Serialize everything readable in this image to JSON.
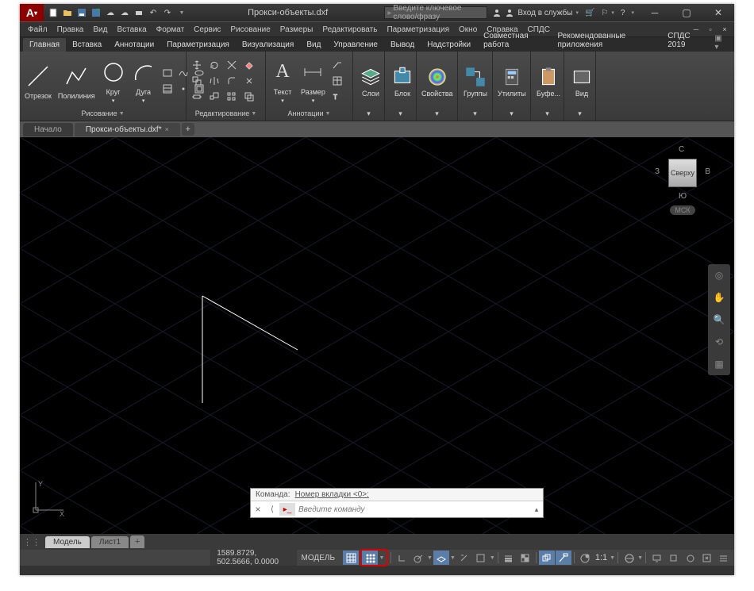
{
  "title_bar": {
    "doc_title": "Прокси-объекты.dxf",
    "search_placeholder": "Введите ключевое слово/фразу",
    "login_label": "Вход в службы",
    "logo_letter": "A"
  },
  "menu": [
    "Файл",
    "Правка",
    "Вид",
    "Вставка",
    "Формат",
    "Сервис",
    "Рисование",
    "Размеры",
    "Редактировать",
    "Параметризация",
    "Окно",
    "Справка",
    "СПДС"
  ],
  "ribbon_tabs": [
    "Главная",
    "Вставка",
    "Аннотации",
    "Параметризация",
    "Визуализация",
    "Вид",
    "Управление",
    "Вывод",
    "Надстройки",
    "Совместная работа",
    "Рекомендованные приложения",
    "СПДС 2019"
  ],
  "ribbon_active_tab": 0,
  "panels": {
    "draw": {
      "title": "Рисование",
      "btn_segment": "Отрезок",
      "btn_polyline": "Полилиния",
      "btn_circle": "Круг",
      "btn_arc": "Дуга"
    },
    "edit": {
      "title": "Редактирование"
    },
    "annot": {
      "title": "Аннотации",
      "btn_text": "Текст",
      "btn_dim": "Размер"
    },
    "layers": {
      "title": "Слои"
    },
    "block": {
      "title": "Блок"
    },
    "props": {
      "title": "Свойства"
    },
    "groups": {
      "title": "Группы"
    },
    "utils": {
      "title": "Утилиты"
    },
    "clip": {
      "title": "Буфе..."
    },
    "view": {
      "title": "Вид"
    }
  },
  "file_tabs": {
    "start": "Начало",
    "active": "Прокси-объекты.dxf*"
  },
  "viewcube": {
    "face": "Сверху",
    "n": "С",
    "s": "Ю",
    "w": "З",
    "e": "В",
    "wcs": "МСК"
  },
  "ucs": {
    "x": "X",
    "y": "Y"
  },
  "command": {
    "history_prefix": "Команда:",
    "history_text": "Номер вкладки <0>:",
    "placeholder": "Введите команду"
  },
  "layout_tabs": {
    "model": "Модель",
    "sheet1": "Лист1"
  },
  "status": {
    "coords": "1589.8729, 502.5666, 0.0000",
    "model": "МОДЕЛЬ",
    "scale": "1:1"
  }
}
